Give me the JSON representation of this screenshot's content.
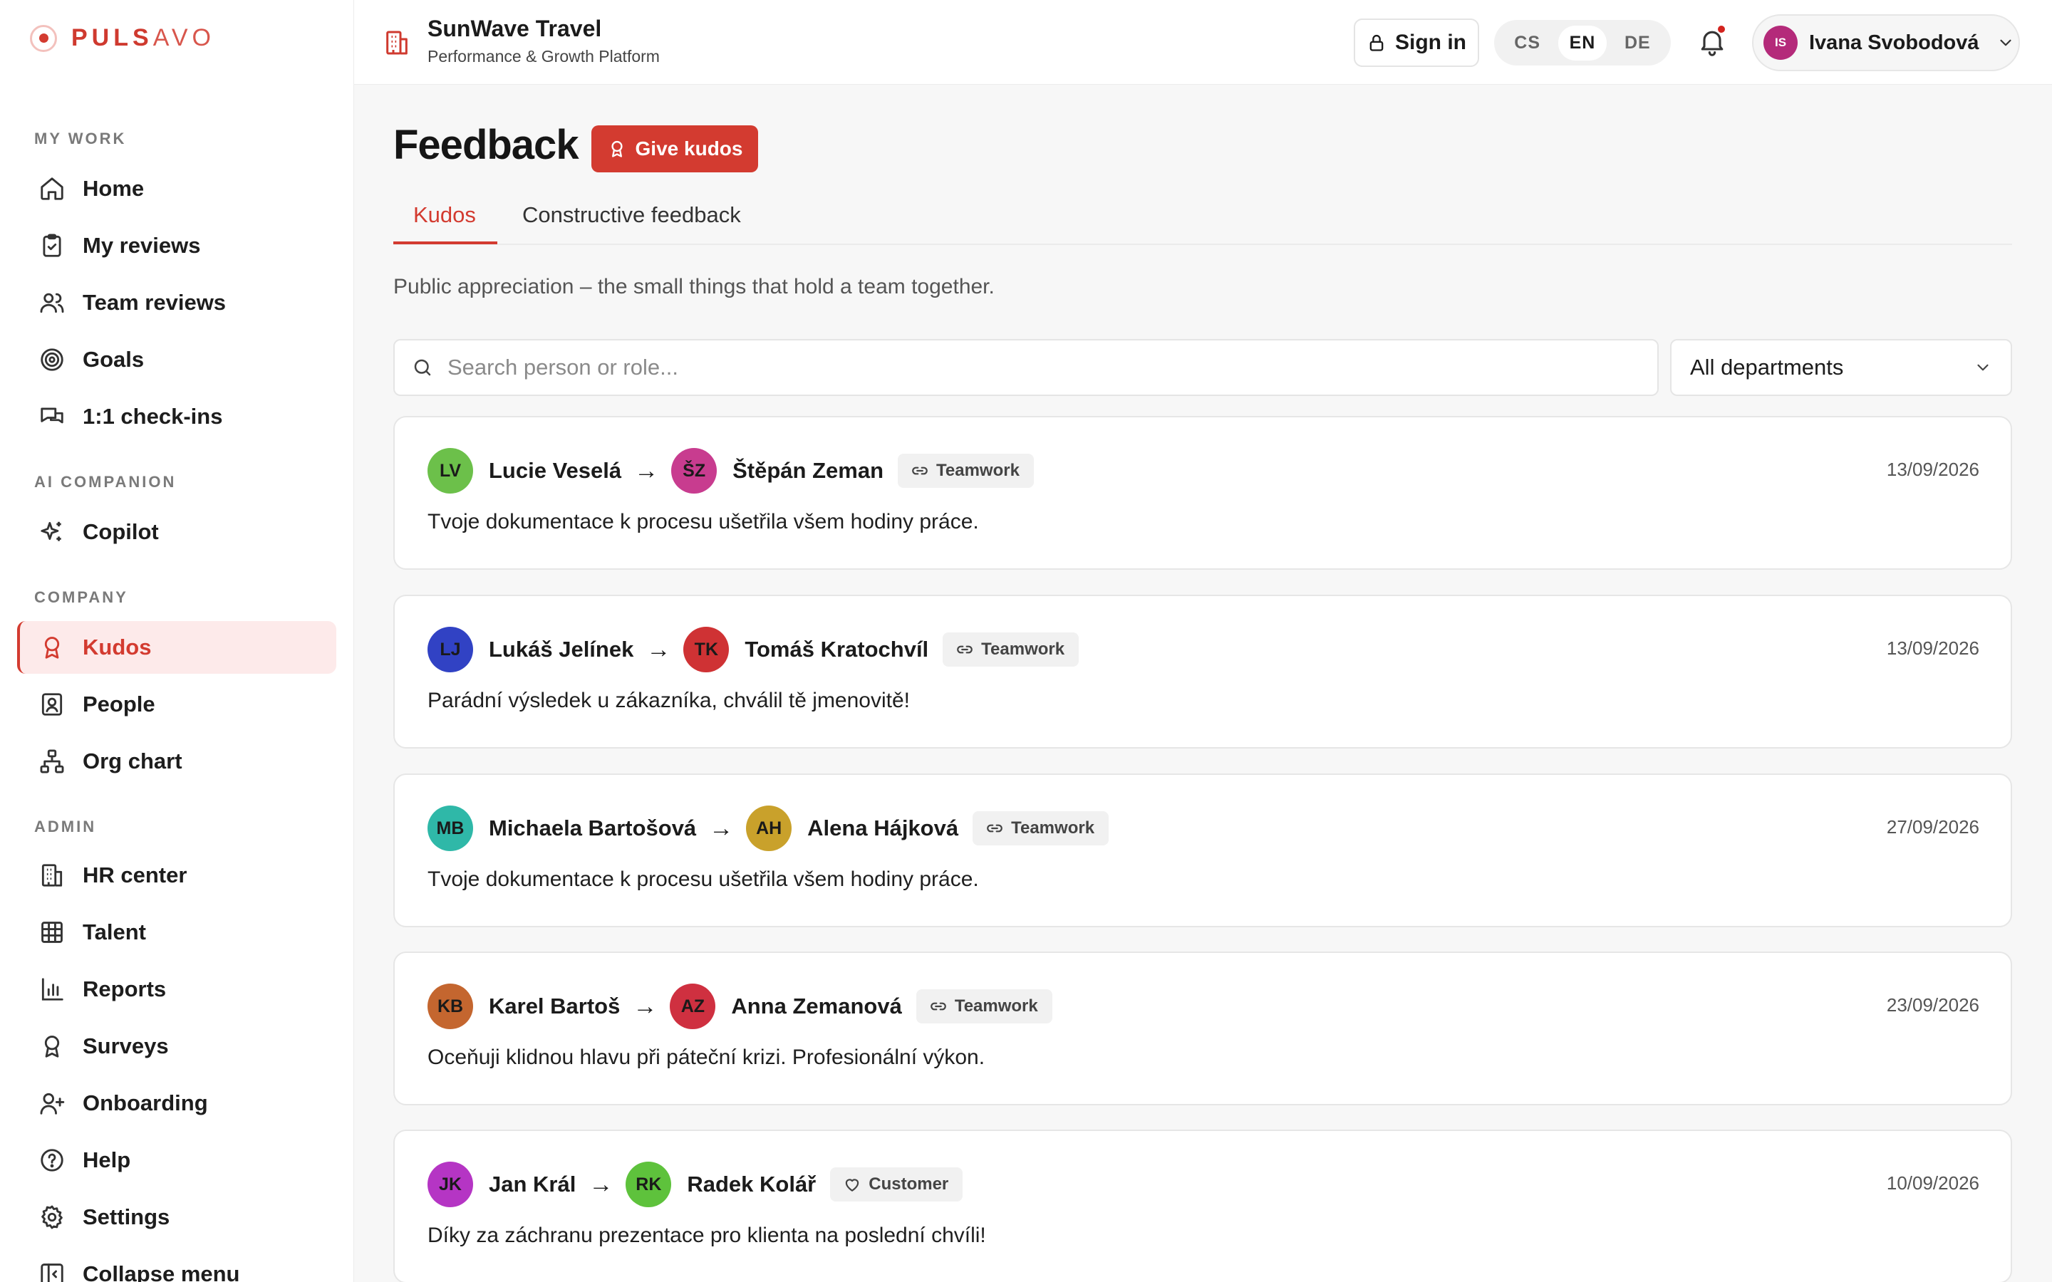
{
  "brand": {
    "name_strong": "PULS",
    "name_light": "AVO",
    "accent": "#d33b30"
  },
  "org": {
    "name": "SunWave Travel",
    "subtitle": "Performance & Growth Platform"
  },
  "topbar": {
    "signin_label": "Sign in",
    "languages": [
      "CS",
      "EN",
      "DE"
    ],
    "active_language": "EN",
    "notification_unread": true,
    "user": {
      "initials": "IS",
      "name": "Ivana Svobodová"
    }
  },
  "sidebar": {
    "sections": {
      "my_work": "MY WORK",
      "ai_companion": "AI COMPANION",
      "company": "COMPANY",
      "admin": "ADMIN"
    },
    "items": {
      "home": "Home",
      "my_reviews": "My reviews",
      "team_reviews": "Team reviews",
      "goals": "Goals",
      "checkins": "1:1 check-ins",
      "copilot": "Copilot",
      "kudos": "Kudos",
      "people": "People",
      "org_chart": "Org chart",
      "hr_center": "HR center",
      "talent": "Talent",
      "reports": "Reports",
      "surveys": "Surveys",
      "onboarding": "Onboarding",
      "help": "Help",
      "settings": "Settings",
      "collapse": "Collapse menu"
    },
    "active_item": "kudos"
  },
  "main": {
    "title": "Feedback",
    "give_kudos_label": "Give kudos",
    "tabs": {
      "kudos": "Kudos",
      "constructive": "Constructive feedback"
    },
    "active_tab": "kudos",
    "subtitle": "Public appreciation – the small things that hold a team together.",
    "search_placeholder": "Search person or role...",
    "department_filter": "All departments",
    "arrow": "→",
    "kudos": [
      {
        "from": {
          "initials": "LV",
          "name": "Lucie Veselá",
          "color": "#6cc04a"
        },
        "to": {
          "initials": "ŠZ",
          "name": "Štěpán Zeman",
          "color": "#c83c8f"
        },
        "tag": "Teamwork",
        "tag_icon": "link-icon",
        "date": "13/09/2026",
        "message": "Tvoje dokumentace k procesu ušetřila všem hodiny práce."
      },
      {
        "from": {
          "initials": "LJ",
          "name": "Lukáš Jelínek",
          "color": "#3142c4"
        },
        "to": {
          "initials": "TK",
          "name": "Tomáš Kratochvíl",
          "color": "#cf3234"
        },
        "tag": "Teamwork",
        "tag_icon": "link-icon",
        "date": "13/09/2026",
        "message": "Parádní výsledek u zákazníka, chválil tě jmenovitě!"
      },
      {
        "from": {
          "initials": "MB",
          "name": "Michaela Bartošová",
          "color": "#2fb8a8"
        },
        "to": {
          "initials": "AH",
          "name": "Alena Hájková",
          "color": "#c9a12b"
        },
        "tag": "Teamwork",
        "tag_icon": "link-icon",
        "date": "27/09/2026",
        "message": "Tvoje dokumentace k procesu ušetřila všem hodiny práce."
      },
      {
        "from": {
          "initials": "KB",
          "name": "Karel Bartoš",
          "color": "#c4662f"
        },
        "to": {
          "initials": "AZ",
          "name": "Anna Zemanová",
          "color": "#cf3040"
        },
        "tag": "Teamwork",
        "tag_icon": "link-icon",
        "date": "23/09/2026",
        "message": "Oceňuji klidnou hlavu při páteční krizi. Profesionální výkon."
      },
      {
        "from": {
          "initials": "JK",
          "name": "Jan Král",
          "color": "#b535c4"
        },
        "to": {
          "initials": "RK",
          "name": "Radek Kolář",
          "color": "#5ec23c"
        },
        "tag": "Customer",
        "tag_icon": "heart-icon",
        "date": "10/09/2026",
        "message": "Díky za záchranu prezentace pro klienta na poslední chvíli!"
      }
    ]
  }
}
